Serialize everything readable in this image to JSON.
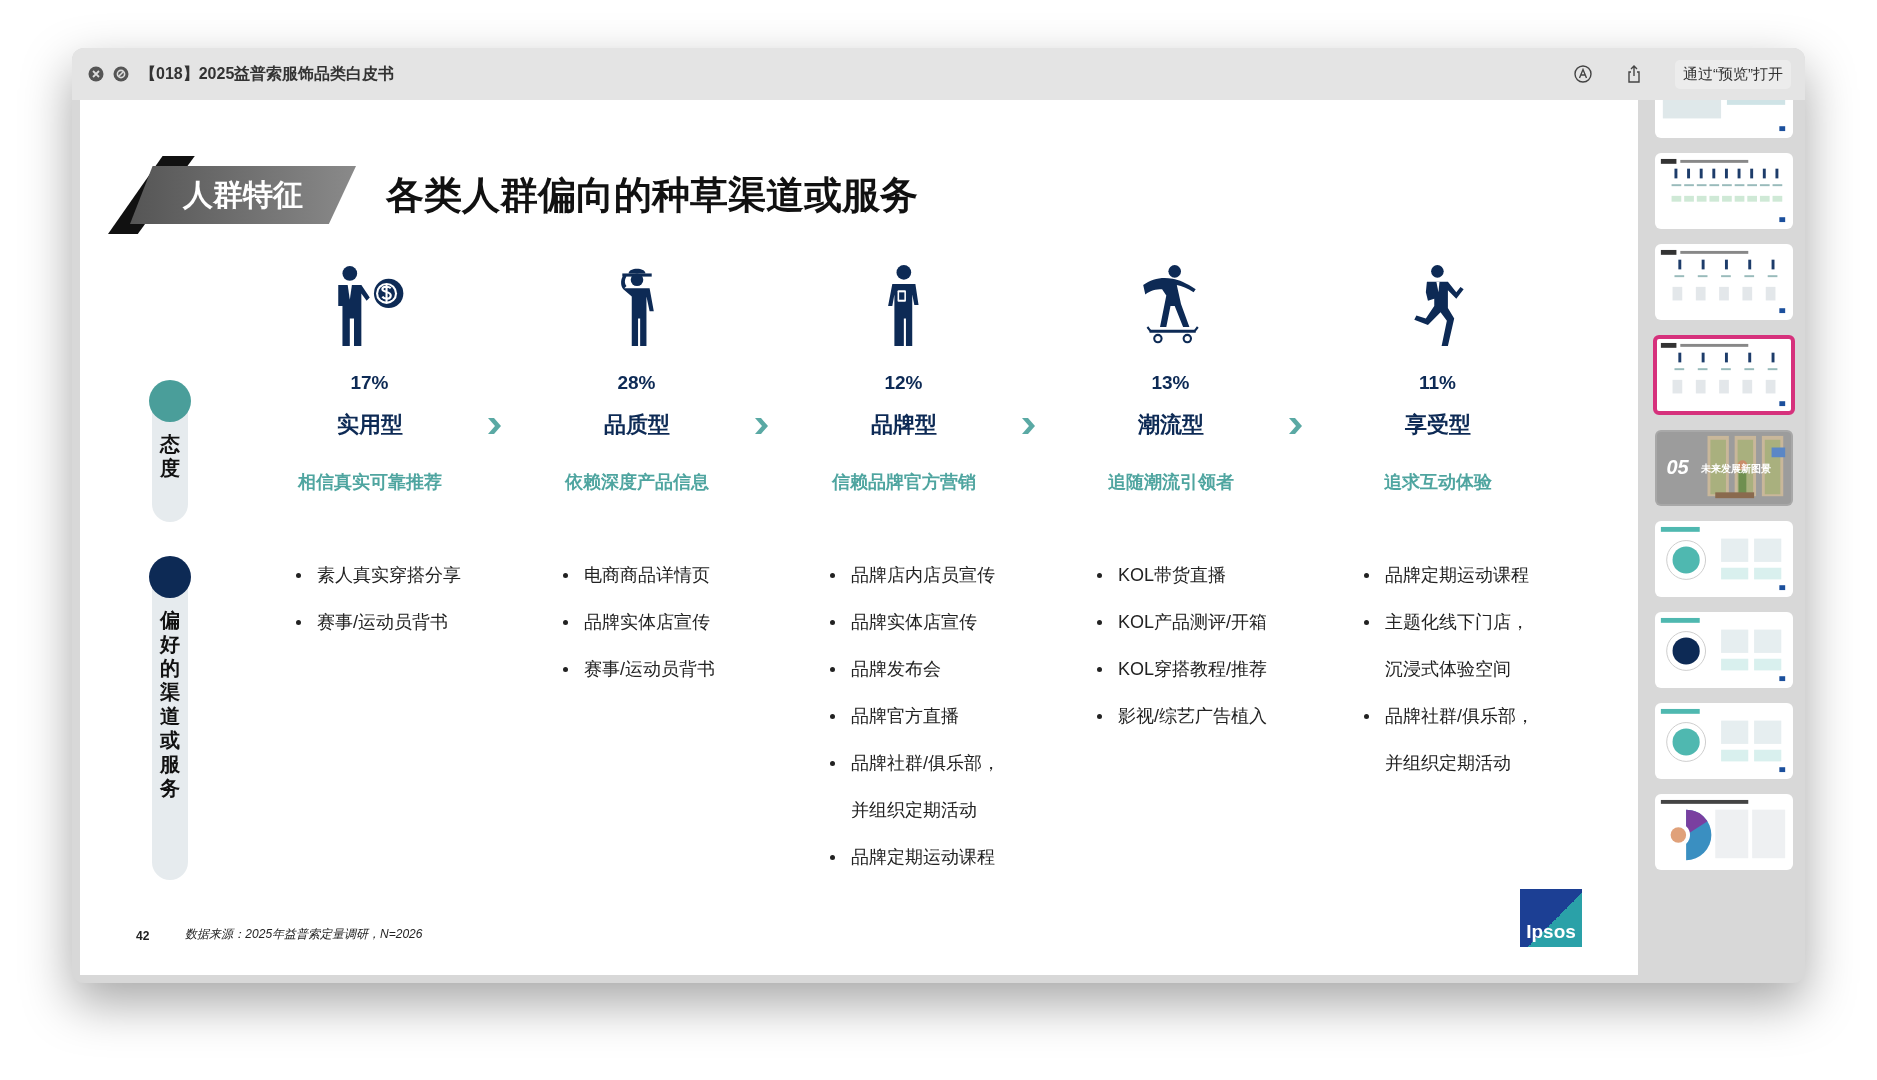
{
  "window": {
    "title": "【018】2025益普索服饰品类白皮书",
    "open_button": "通过“预览”打开"
  },
  "slide": {
    "badge": "人群特征",
    "title": "各类人群偏向的种草渠道或服务",
    "side_labels": [
      {
        "kind": "attitude",
        "text": "态度",
        "color": "#4a9e9a"
      },
      {
        "kind": "channels",
        "text": "偏好的渠道或服务",
        "color": "#0d2a55"
      }
    ],
    "personas": [
      {
        "kind": "coin",
        "share": "17%",
        "name": "实用型",
        "tagline": "相信真实可靠推荐",
        "channels": [
          [
            "素人真实穿搭分享"
          ],
          [
            "赛事/运动员背书"
          ]
        ]
      },
      {
        "kind": "hat",
        "share": "28%",
        "name": "品质型",
        "tagline": "依赖深度产品信息",
        "channels": [
          [
            "电商商品详情页"
          ],
          [
            "品牌实体店宣传"
          ],
          [
            "赛事/运动员背书"
          ]
        ]
      },
      {
        "kind": "phone",
        "share": "12%",
        "name": "品牌型",
        "tagline": "信赖品牌官方营销",
        "channels": [
          [
            "品牌店内店员宣传"
          ],
          [
            "品牌实体店宣传"
          ],
          [
            "品牌发布会"
          ],
          [
            "品牌官方直播"
          ],
          [
            "品牌社群/俱乐部，",
            "并组织定期活动"
          ],
          [
            "品牌定期运动课程"
          ]
        ]
      },
      {
        "kind": "skate",
        "share": "13%",
        "name": "潮流型",
        "tagline": "追随潮流引领者",
        "channels": [
          [
            "KOL带货直播"
          ],
          [
            "KOL产品测评/开箱"
          ],
          [
            "KOL穿搭教程/推荐"
          ],
          [
            "影视/综艺广告植入"
          ]
        ]
      },
      {
        "kind": "run",
        "share": "11%",
        "name": "享受型",
        "tagline": "追求互动体验",
        "channels": [
          [
            "品牌定期运动课程"
          ],
          [
            "主题化线下门店，",
            "沉浸式体验空间"
          ],
          [
            "品牌社群/俱乐部，",
            "并组织定期活动"
          ]
        ]
      }
    ],
    "page_number": "42",
    "source": "数据来源：2025年益普索定量调研，N=2026",
    "logo": "Ipsos"
  },
  "thumbnails": [
    {
      "kind": "photos",
      "selected": false
    },
    {
      "kind": "table",
      "selected": false
    },
    {
      "kind": "columns",
      "selected": false
    },
    {
      "kind": "columns",
      "selected": true
    },
    {
      "kind": "section",
      "selected": false,
      "number": "05",
      "title": "未来发展新图景"
    },
    {
      "kind": "circle",
      "selected": false,
      "color": "#4fb8b0"
    },
    {
      "kind": "circle",
      "selected": false,
      "color": "#0d2a55"
    },
    {
      "kind": "circle",
      "selected": false,
      "color": "#4fb8b0"
    },
    {
      "kind": "wheel",
      "selected": false
    }
  ]
}
